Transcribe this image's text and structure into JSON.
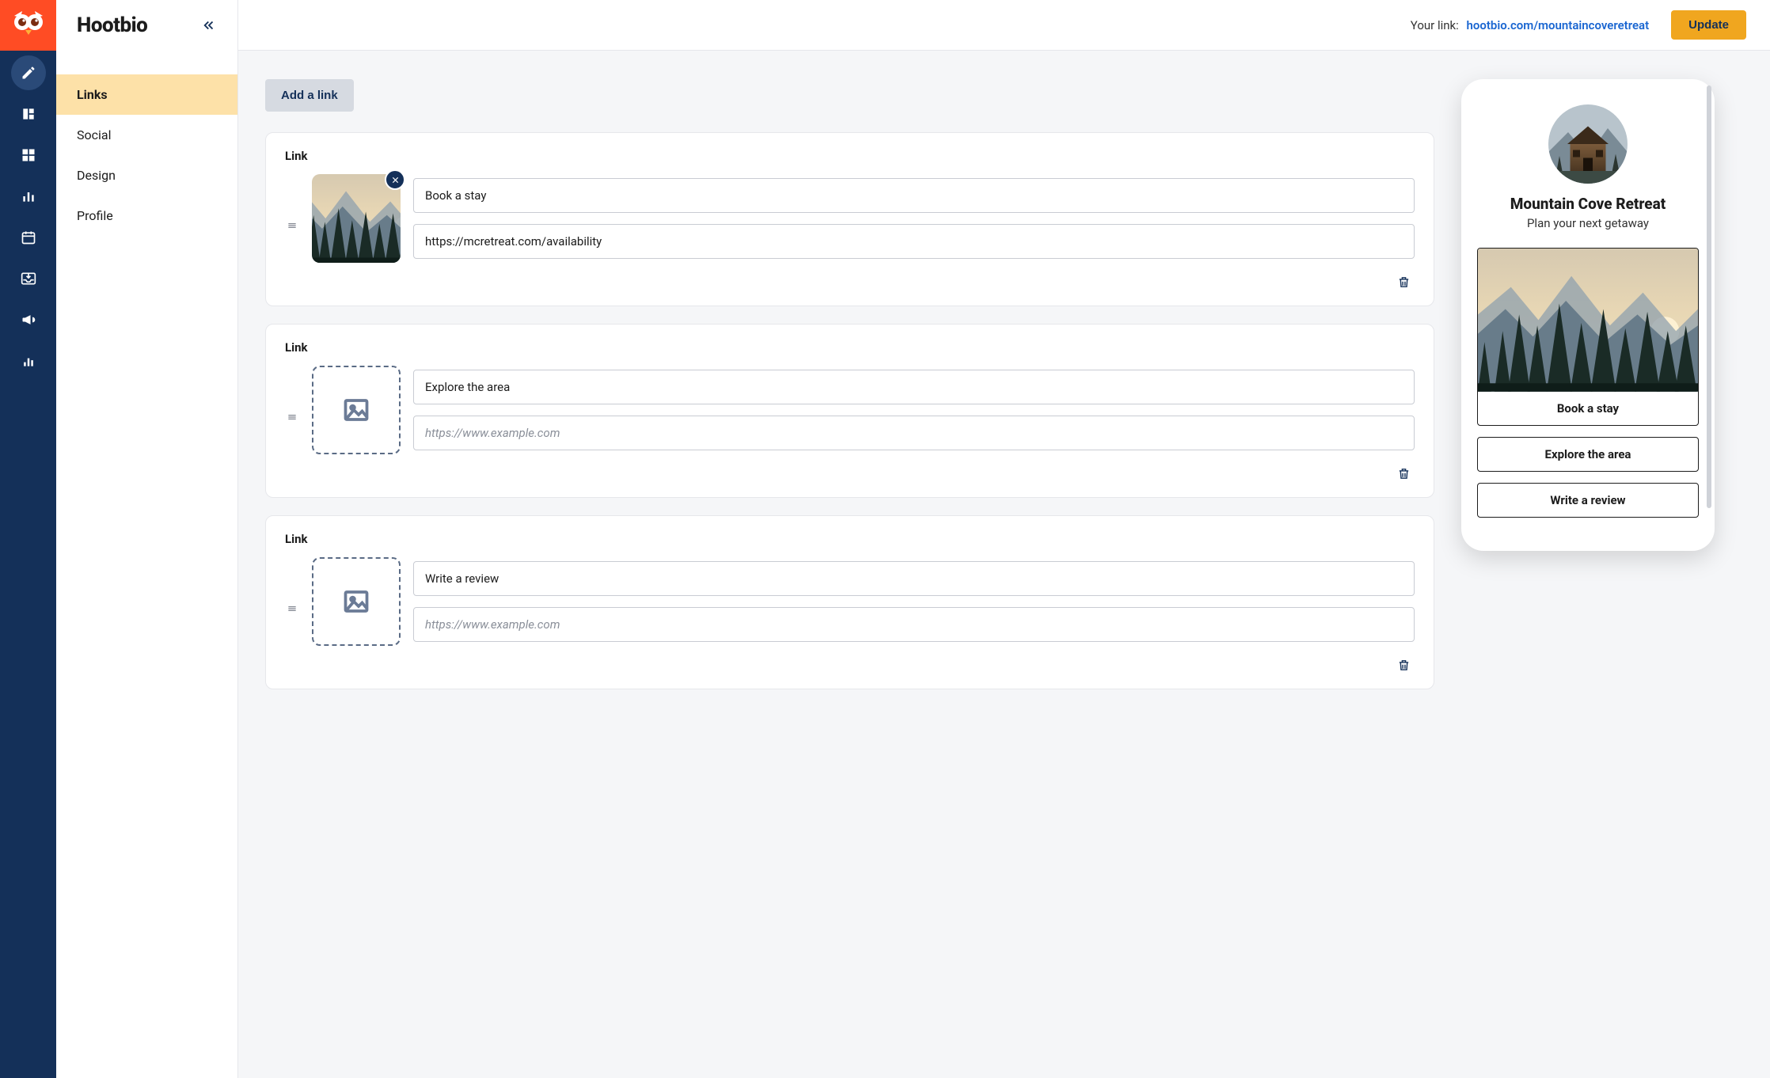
{
  "rail": {
    "items": [
      "compose",
      "style",
      "grid",
      "analytics-bars",
      "calendar",
      "inbox",
      "megaphone",
      "chart"
    ]
  },
  "sidebar": {
    "title": "Hootbio",
    "nav": [
      {
        "label": "Links",
        "active": true
      },
      {
        "label": "Social",
        "active": false
      },
      {
        "label": "Design",
        "active": false
      },
      {
        "label": "Profile",
        "active": false
      }
    ]
  },
  "topbar": {
    "yourlink_label": "Your link:",
    "yourlink_url": "hootbio.com/mountaincoveretreat",
    "update_label": "Update"
  },
  "editor": {
    "add_link_label": "Add a link",
    "link_heading": "Link",
    "url_placeholder": "https://www.example.com",
    "cards": [
      {
        "title": "Book a stay",
        "url": "https://mcretreat.com/availability",
        "has_image": true
      },
      {
        "title": "Explore the area",
        "url": "",
        "has_image": false
      },
      {
        "title": "Write a review",
        "url": "",
        "has_image": false
      }
    ]
  },
  "preview": {
    "name": "Mountain Cove Retreat",
    "tagline": "Plan your next getaway",
    "links": [
      {
        "label": "Book a stay",
        "has_image": true
      },
      {
        "label": "Explore the area",
        "has_image": false
      },
      {
        "label": "Write a review",
        "has_image": false
      }
    ]
  }
}
